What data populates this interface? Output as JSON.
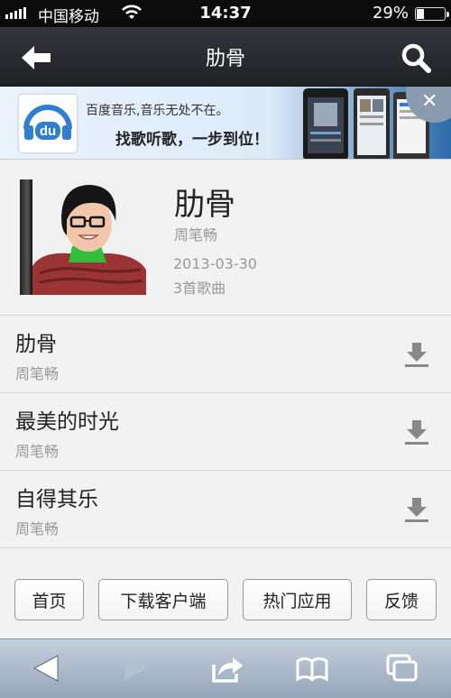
{
  "status": {
    "carrier": "中国移动",
    "time": "14:37",
    "battery_text": "29%",
    "battery_level": 0.29,
    "icons": [
      "signal-icon",
      "wifi-icon",
      "battery-icon"
    ]
  },
  "navbar": {
    "title": "肋骨",
    "back_icon": "back-arrow-icon",
    "search_icon": "search-icon"
  },
  "banner": {
    "logo_text": "du",
    "line1": "百度音乐,音乐无处不在。",
    "line2": "找歌听歌，一步到位！",
    "close_icon": "close-icon"
  },
  "album": {
    "title": "肋骨",
    "artist": "周笔畅",
    "date": "2013-03-30",
    "count": "3首歌曲"
  },
  "songs": [
    {
      "title": "肋骨",
      "artist": "周笔畅"
    },
    {
      "title": "最美的时光",
      "artist": "周笔畅"
    },
    {
      "title": "自得其乐",
      "artist": "周笔畅"
    }
  ],
  "footer": {
    "buttons": [
      "首页",
      "下载客户端",
      "热门应用",
      "反馈"
    ]
  },
  "toolbar": {
    "icons": [
      "browser-back-icon",
      "browser-forward-icon",
      "share-icon",
      "bookmarks-icon",
      "tabs-icon"
    ]
  },
  "colors": {
    "navbar": "#26282d",
    "baidu_blue": "#2f7fd1",
    "toolbar": "#a9b7c8"
  }
}
